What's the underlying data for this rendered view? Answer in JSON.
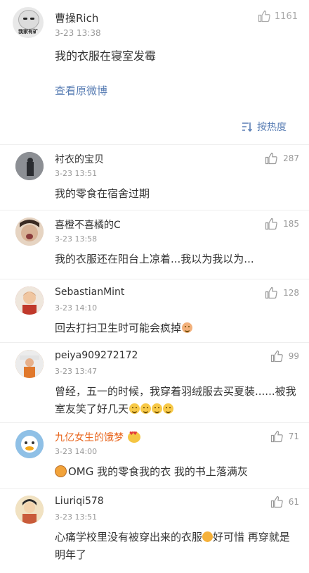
{
  "post": {
    "author": "曹操Rich",
    "avatar_text": "我家有矿",
    "time": "3-23 13:38",
    "likes": "1161",
    "content": "我的衣服在寝室发霉",
    "view_original": "查看原微博"
  },
  "sort": {
    "label": "按热度"
  },
  "comments": [
    {
      "name": "衬衣的宝贝",
      "time": "3-23 13:51",
      "likes": "287",
      "text": "我的零食在宿舍过期",
      "avatar_color": "#5a5f66"
    },
    {
      "name": "喜橙不喜橘的C",
      "time": "3-23 13:58",
      "likes": "185",
      "text": "我的衣服还在阳台上凉着...我以为我以为...",
      "avatar_color": "#c9a98e"
    },
    {
      "name": "SebastianMint",
      "time": "3-23 14:10",
      "likes": "128",
      "text": "回去打扫卫生时可能会疯掉",
      "avatar_color": "#b8402e"
    },
    {
      "name": "peiya909272172",
      "time": "3-23 13:47",
      "likes": "99",
      "text": "曾经，五一的时候，我穿着羽绒服去买夏装......被我室友笑了好几天",
      "avatar_color": "#d98a3c"
    },
    {
      "name": "九亿女生的饿梦",
      "time": "3-23 14:00",
      "likes": "71",
      "text": "OMG  我的零食我的衣 我的书上落满灰",
      "avatar_color": "#7fb0d8",
      "vip": true
    },
    {
      "name": "Liuriqi578",
      "time": "3-23 13:51",
      "likes": "61",
      "text": "心痛学校里没有被穿出来的衣服",
      "text2": "好可惜 再穿就是明年了",
      "avatar_color": "#d9b26a"
    }
  ]
}
